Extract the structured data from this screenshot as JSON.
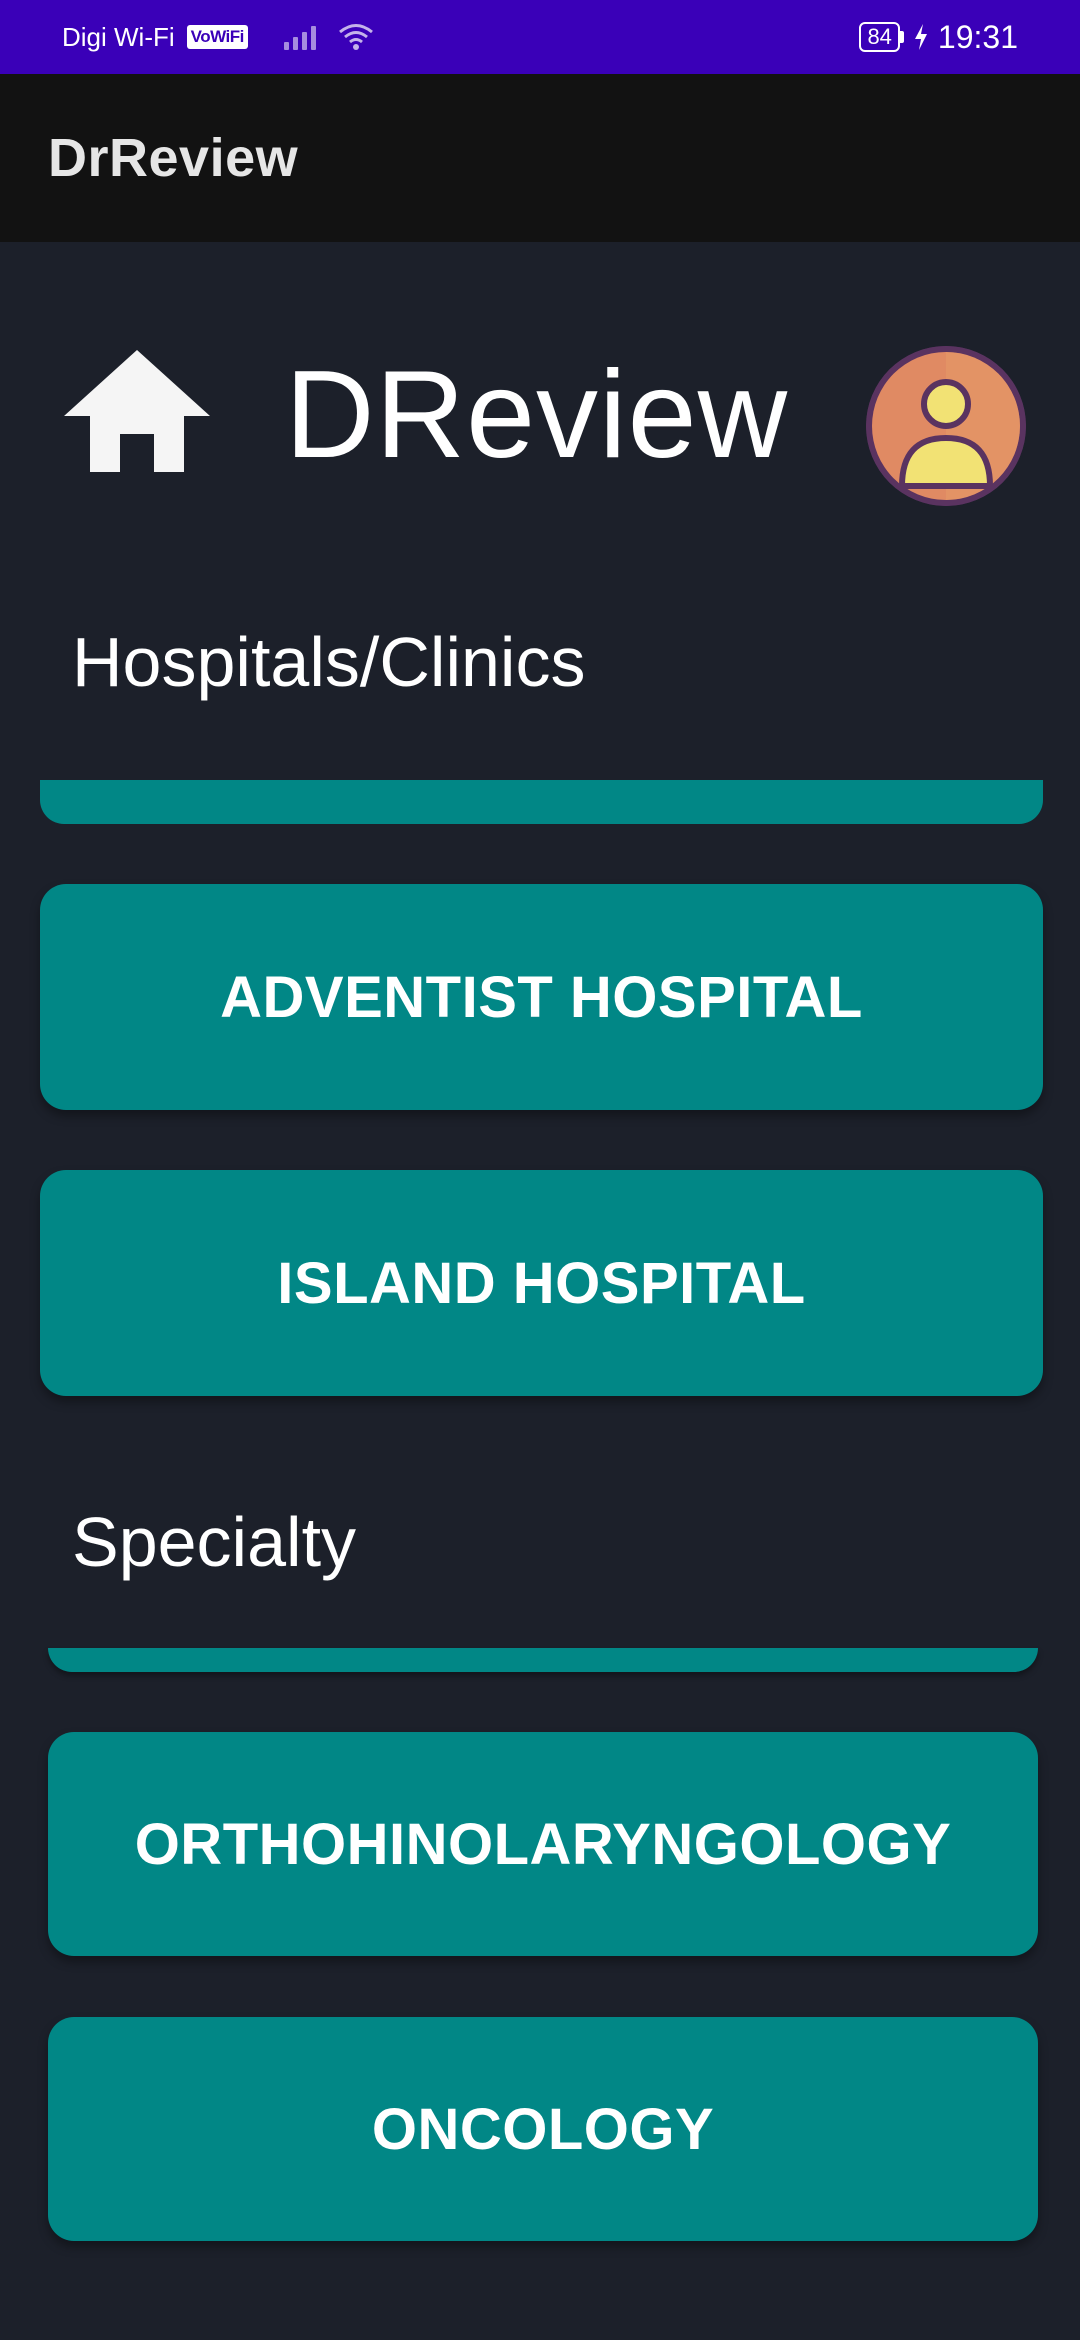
{
  "status_bar": {
    "carrier": "Digi Wi-Fi",
    "vowifi_badge": "VoWiFi",
    "battery_level": "84",
    "time": "19:31"
  },
  "app_bar": {
    "title": "DrReview"
  },
  "header": {
    "brand_title": "DReview",
    "home_icon": "home-icon",
    "avatar_icon": "user-avatar-icon"
  },
  "hospitals": {
    "label": "Hospitals/Clinics",
    "items": [
      {
        "label": "ADVENTIST HOSPITAL"
      },
      {
        "label": "ISLAND HOSPITAL"
      }
    ]
  },
  "specialty": {
    "label": "Specialty",
    "items": [
      {
        "label": "ORTHOHINOLARYNGOLOGY"
      },
      {
        "label": "ONCOLOGY"
      }
    ]
  },
  "colors": {
    "status_bar": "#3a00b8",
    "app_bar": "#121212",
    "background": "#1c202a",
    "card_teal": "#018786",
    "avatar_bg": "#e08a63",
    "avatar_figure": "#f2e274"
  }
}
